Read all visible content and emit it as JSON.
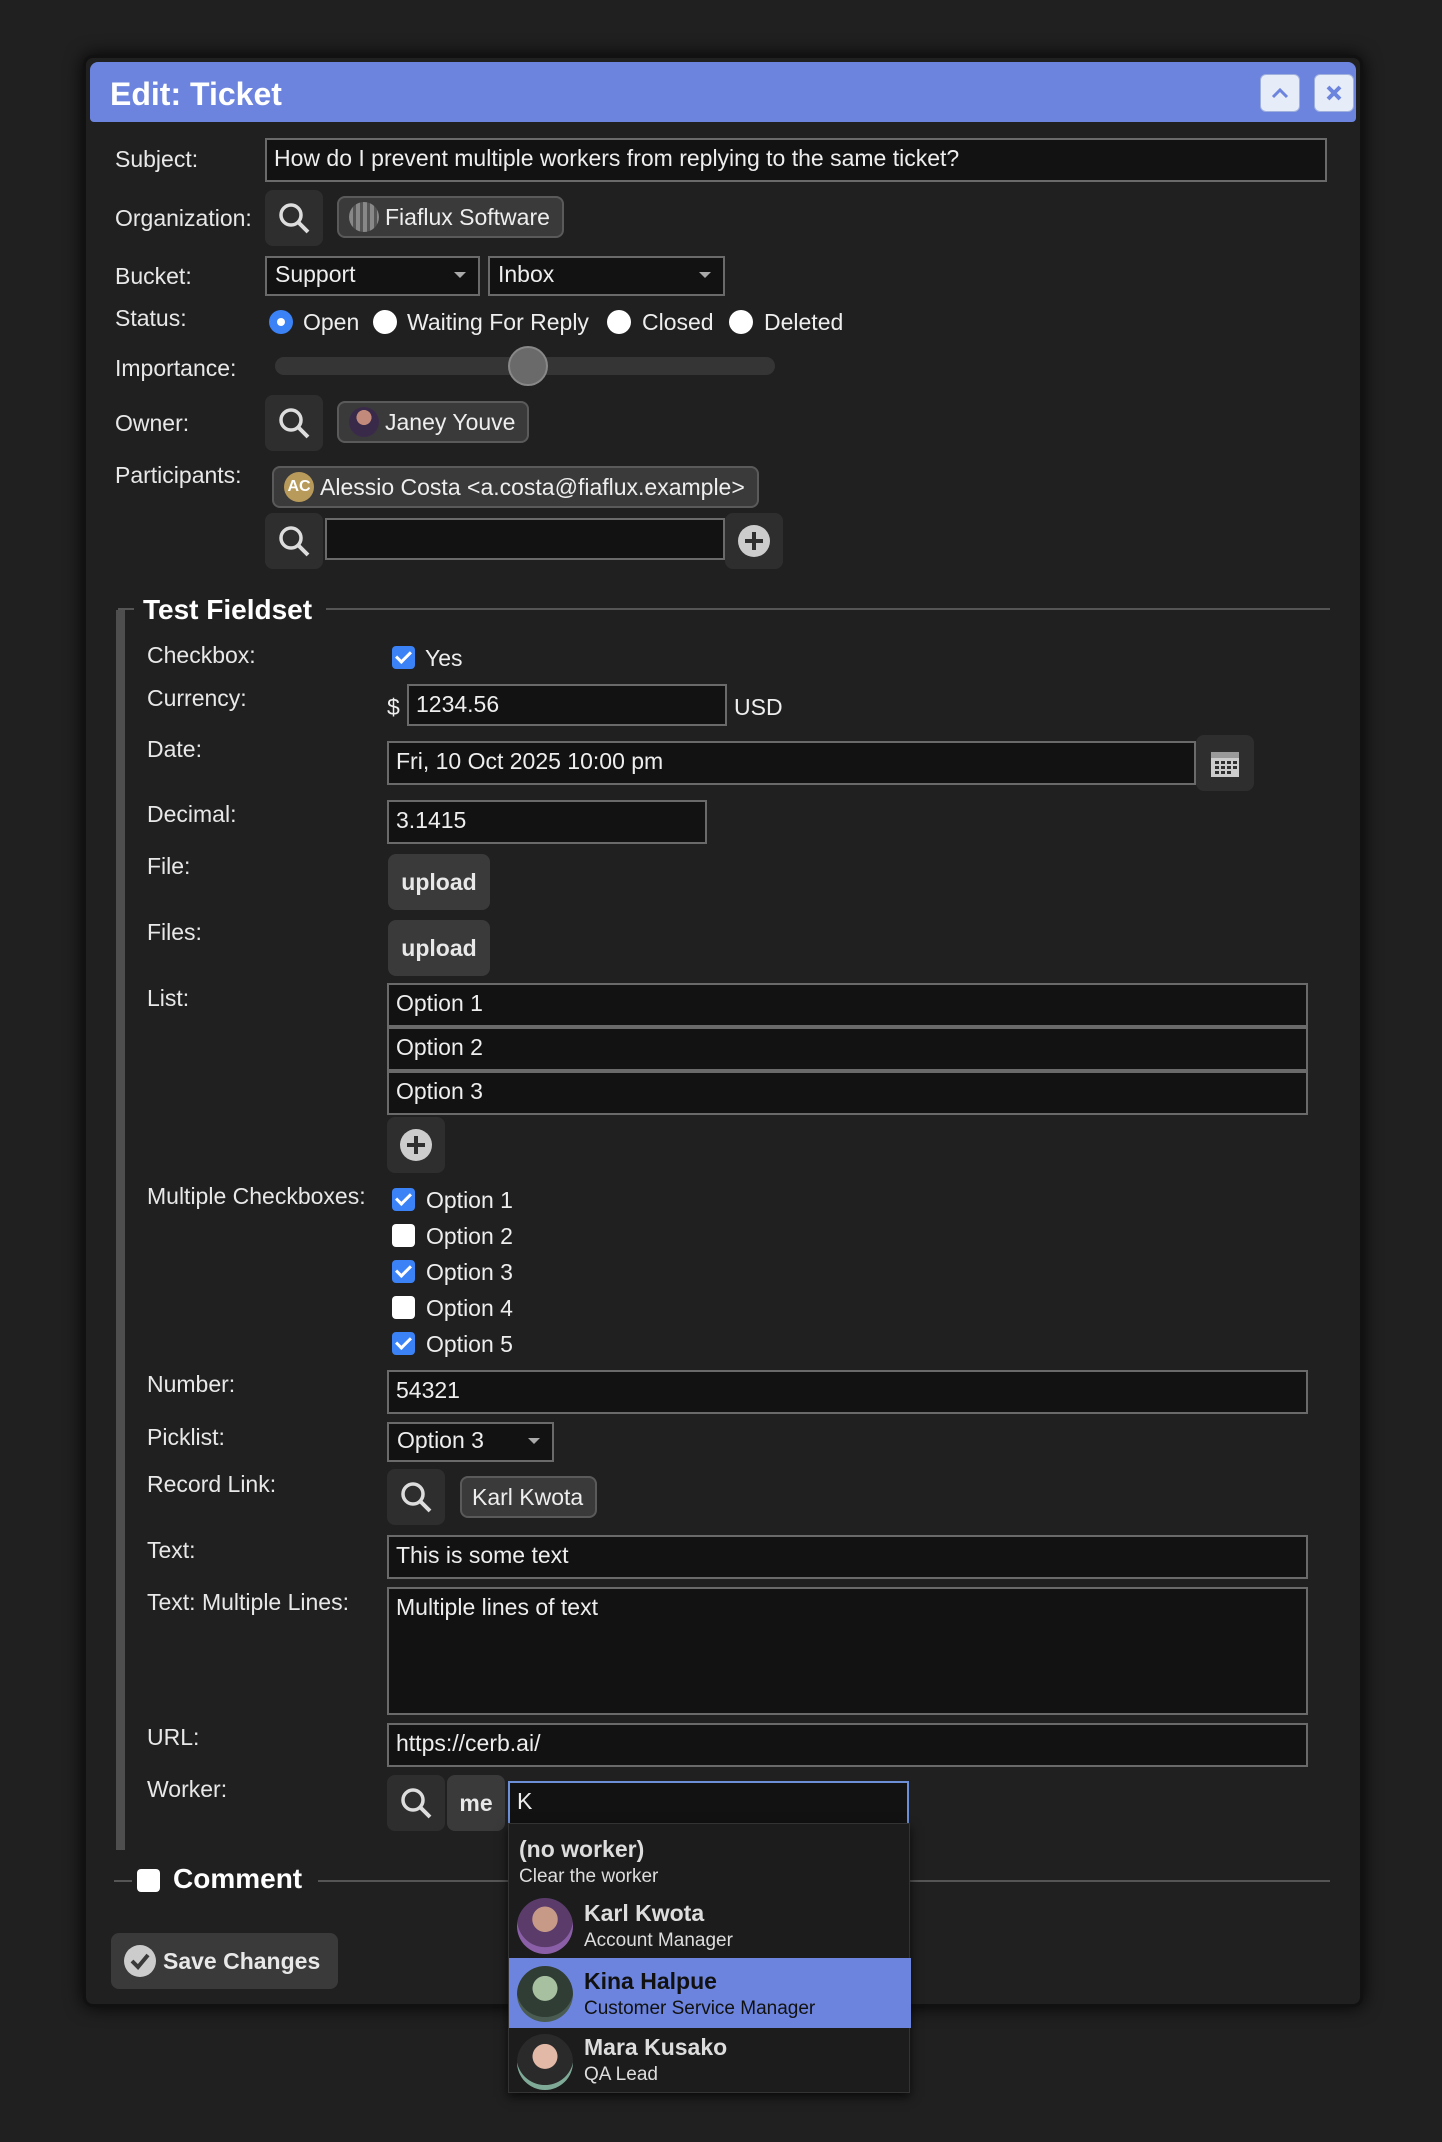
{
  "dialog": {
    "title": "Edit: Ticket",
    "collapse_icon": "chevron-up-icon",
    "close_icon": "close-icon"
  },
  "form": {
    "subject": {
      "label": "Subject:",
      "value": "How do I prevent multiple workers from replying to the same ticket?"
    },
    "organization": {
      "label": "Organization:",
      "value": "Fiaflux Software"
    },
    "bucket": {
      "label": "Bucket:",
      "group": "Support",
      "bucket": "Inbox"
    },
    "status": {
      "label": "Status:",
      "options": [
        "Open",
        "Waiting For Reply",
        "Closed",
        "Deleted"
      ],
      "selected": "Open"
    },
    "importance": {
      "label": "Importance:",
      "value": 0.5
    },
    "owner": {
      "label": "Owner:",
      "value": "Janey Youve"
    },
    "participants": {
      "label": "Participants:",
      "initials": "AC",
      "value": "Alessio Costa <a.costa@fiaflux.example>",
      "input": ""
    }
  },
  "fieldset": {
    "legend": "Test Fieldset",
    "checkbox": {
      "label": "Checkbox:",
      "text": "Yes",
      "checked": true
    },
    "currency": {
      "label": "Currency:",
      "symbol": "$",
      "value": "1234.56",
      "code": "USD"
    },
    "date": {
      "label": "Date:",
      "value": "Fri, 10 Oct 2025 10:00 pm"
    },
    "decimal": {
      "label": "Decimal:",
      "value": "3.1415"
    },
    "file": {
      "label": "File:",
      "button": "upload"
    },
    "files": {
      "label": "Files:",
      "button": "upload"
    },
    "list": {
      "label": "List:",
      "items": [
        "Option 1",
        "Option 2",
        "Option 3"
      ]
    },
    "multi": {
      "label": "Multiple Checkboxes:",
      "items": [
        {
          "text": "Option 1",
          "checked": true
        },
        {
          "text": "Option 2",
          "checked": false
        },
        {
          "text": "Option 3",
          "checked": true
        },
        {
          "text": "Option 4",
          "checked": false
        },
        {
          "text": "Option 5",
          "checked": true
        }
      ]
    },
    "number": {
      "label": "Number:",
      "value": "54321"
    },
    "picklist": {
      "label": "Picklist:",
      "value": "Option 3"
    },
    "record_link": {
      "label": "Record Link:",
      "value": "Karl Kwota"
    },
    "text": {
      "label": "Text:",
      "value": "This is some text"
    },
    "textarea": {
      "label": "Text: Multiple Lines:",
      "value": "Multiple lines of text"
    },
    "url": {
      "label": "URL:",
      "value": "https://cerb.ai/"
    },
    "worker": {
      "label": "Worker:",
      "me": "me",
      "input": "K"
    }
  },
  "comment": {
    "legend": "Comment",
    "checked": false
  },
  "save_button": "Save Changes",
  "autocomplete": [
    {
      "name": "(no worker)",
      "sub": "Clear the worker",
      "highlight": false
    },
    {
      "name": "Karl Kwota",
      "sub": "Account Manager",
      "highlight": false
    },
    {
      "name": "Kina Halpue",
      "sub": "Customer Service Manager",
      "highlight": true
    },
    {
      "name": "Mara Kusako",
      "sub": "QA Lead",
      "highlight": false
    }
  ],
  "colors": {
    "accent": "#6c84dd",
    "checkbox": "#3b82f6",
    "highlight": "#6c84dd"
  }
}
